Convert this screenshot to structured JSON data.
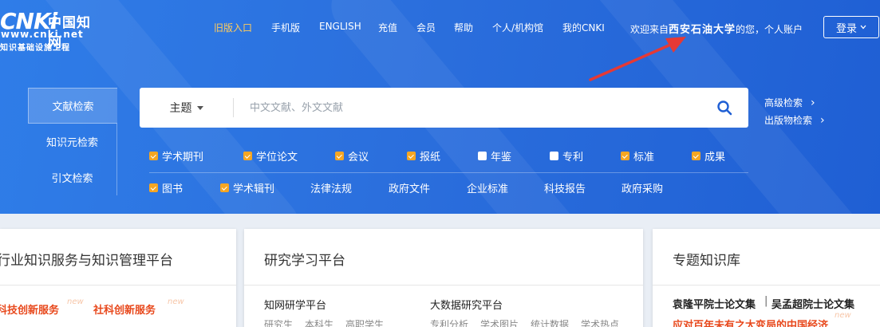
{
  "logo": {
    "brand": "CNKi",
    "brand_cn": "中国知网",
    "url": "www.cnki.net",
    "tagline": "知识基础设施工程"
  },
  "topnav": {
    "items": [
      "旧版入口",
      "手机版",
      "ENGLISH",
      "充值",
      "会员",
      "帮助",
      "个人/机构馆",
      "我的CNKI"
    ],
    "welcome_prefix": "欢迎来自",
    "welcome_org": "西安石油大学",
    "welcome_suffix": "的您，个人账户",
    "login_label": "登录"
  },
  "search": {
    "tabs": [
      "文献检索",
      "知识元检索",
      "引文检索"
    ],
    "field_label": "主题",
    "placeholder": "中文文献、外文文献",
    "advanced_link": "高级检索",
    "publication_link": "出版物检索"
  },
  "sources": {
    "row1": [
      {
        "label": "学术期刊",
        "checked": true
      },
      {
        "label": "学位论文",
        "checked": true
      },
      {
        "label": "会议",
        "checked": true
      },
      {
        "label": "报纸",
        "checked": true
      },
      {
        "label": "年鉴",
        "checked": false
      },
      {
        "label": "专利",
        "checked": false
      },
      {
        "label": "标准",
        "checked": true
      },
      {
        "label": "成果",
        "checked": true
      }
    ],
    "row2_checked": [
      {
        "label": "图书",
        "checked": true
      },
      {
        "label": "学术辑刊",
        "checked": true
      }
    ],
    "row2_plain": [
      "法律法规",
      "政府文件",
      "企业标准",
      "科技报告",
      "政府采购"
    ]
  },
  "cards": {
    "industry": {
      "title": "行业知识服务与知识管理平台",
      "link1": "科技创新服务",
      "link2": "社科创新服务",
      "new_tag": "new"
    },
    "research": {
      "title": "研究学习平台",
      "col1_title": "知网研学平台",
      "col1_links": [
        "研究生",
        "本科生",
        "高职学生"
      ],
      "col2_title": "大数据研究平台",
      "col2_links": [
        "专利分析",
        "学术图片",
        "统计数据",
        "学术热点"
      ]
    },
    "topics": {
      "title": "专题知识库",
      "link1": "袁隆平院士论文集",
      "divider": "|",
      "link2": "吴孟超院士论文集",
      "link3": "应对百年未有之大变局的中国经济",
      "new_tag": "new"
    }
  },
  "colors": {
    "hero_blue": "#2b6fdd",
    "accent_orange": "#f5a623",
    "old_entry_yellow": "#ffcc5c",
    "search_icon": "#1f5fd4",
    "arrow_red": "#e53935",
    "link_red": "#e8491d"
  }
}
